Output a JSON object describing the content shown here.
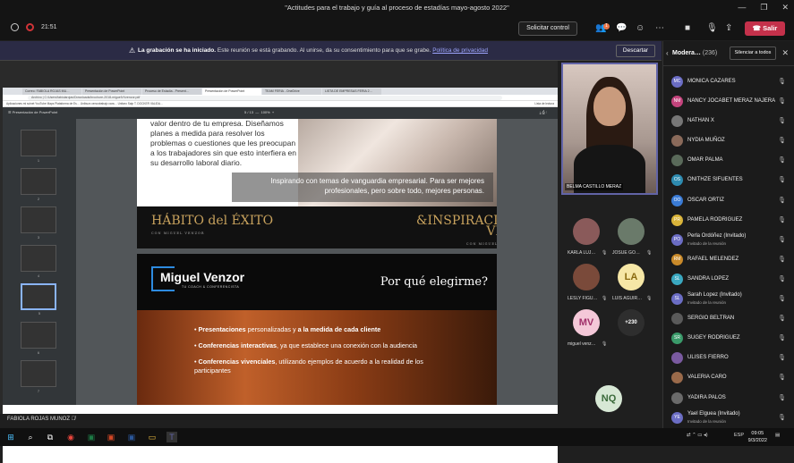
{
  "window": {
    "title": "\"Actitudes para el trabajo y guía al proceso de estadías mayo-agosto 2022\"",
    "timer": "21:51"
  },
  "toolbar": {
    "request_control": "Solicitar control",
    "participants_badge": "1",
    "leave": "Salir"
  },
  "banner": {
    "bold": "La grabación se ha iniciado.",
    "text": "Este reunión se está grabando. Al unirse, da su consentimiento para que se grabe.",
    "link": "Política de privacidad",
    "dismiss": "Descartar"
  },
  "browser": {
    "tabs": [
      "Correo: FABIOLA ROJAS MU…",
      "Presentación de PowerPoint",
      "Proceso de Estadía - Present…",
      "Presentación de PowerPoint",
      "TEAM FERIA - OneDrive",
      "LISTA DE EMPRESAS FERIA 2…"
    ],
    "url": "Archivo | C:/Users/fabiolarojas/Downloads/brochure-2018-miguelVVzenzor.pdf",
    "bookmarks": "Aplicaciones  mi scinet  YouTube  Maps  Plataforma de Es…  Unibuzz  cencotrabajo cara…  Unitaro Salp  T. DOCKER VALIDA…",
    "bookmarks_right": "Lista de lectura",
    "pdf_title": "Presentación de PowerPoint",
    "page_indicator": "5 / 13",
    "zoom": "100%"
  },
  "thumbnails": [
    "1",
    "2",
    "3",
    "4",
    "5",
    "6",
    "7"
  ],
  "slide1": {
    "body": "valor dentro de tu empresa. Diseñamos planes a medida para resolver los problemas o cuestiones que les preocupan a los trabajadores sin que esto interfiera en su desarrollo laboral diario.",
    "quote": "Inspirando con temas de vanguardia empresarial. Para ser mejores profesionales, pero sobre todo, mejores personas.",
    "logo_left": "HÁBITO del ÉXITO",
    "logo_left_sub": "CON MIGUEL VENZOR",
    "logo_right": "&INSPIRACIÓN VIDA",
    "logo_right_sub": "CON MIGUEL VENZOR"
  },
  "slide2": {
    "brand": "Miguel Venzor",
    "brand_sub": "TU COACH & CONFERENCISTA",
    "heading": "Por qué elegirme?",
    "bullets": [
      {
        "bold": "Presentaciones",
        "rest": " personalizadas y ",
        "bold2": "a la medida de cada cliente",
        "rest2": ""
      },
      {
        "bold": "Conferencias interactivas",
        "rest": ", ya que establece una conexión con la audiencia",
        "bold2": "",
        "rest2": ""
      },
      {
        "bold": "Conferencias vivenciales",
        "rest": ", utilizando ejemplos de acuerdo a la realidad de los participantes",
        "bold2": "",
        "rest2": ""
      }
    ]
  },
  "presenter_name": "FABIOLA ROJAS MUNOZ",
  "spotlight": {
    "name": "BELMA CASTILLO MERAZ"
  },
  "tiles": [
    {
      "name": "KARLA LUJ…",
      "initials": "",
      "color": "#8a5a5a"
    },
    {
      "name": "JOSUE GO…",
      "initials": "",
      "color": "#6a7a6a"
    },
    {
      "name": "LESLY FIGU…",
      "initials": "",
      "color": "#7a4a3a"
    },
    {
      "name": "LUIS AGUIR…",
      "initials": "LA",
      "color": "#f6e7a6"
    },
    {
      "name": "miguel venz…",
      "initials": "MV",
      "color": "#f4c8d8"
    },
    {
      "name": "",
      "initials": "+230",
      "color": "#2e2e2e"
    },
    {
      "name": "",
      "initials": "NQ",
      "color": "#d7e8d5"
    }
  ],
  "sidebar": {
    "title": "Modera…",
    "count": "(236)",
    "mute_all": "Silenciar a todos",
    "participants": [
      {
        "name": "MONICA CAZARES",
        "sub": "",
        "initials": "MC",
        "color": "#6b6dc4"
      },
      {
        "name": "NANCY JOCABET MERAZ NAJERA",
        "sub": "",
        "initials": "NM",
        "color": "#c4447d"
      },
      {
        "name": "NATHAN X",
        "sub": "",
        "initials": "",
        "color": "#777777"
      },
      {
        "name": "NYDIA MUÑOZ",
        "sub": "",
        "initials": "",
        "color": "#8a6a5a"
      },
      {
        "name": "OMAR PALMA",
        "sub": "",
        "initials": "",
        "color": "#5a6a5a"
      },
      {
        "name": "ONITHZE SIFUENTES",
        "sub": "",
        "initials": "OS",
        "color": "#2e8bb0"
      },
      {
        "name": "OSCAR ORTIZ",
        "sub": "",
        "initials": "OO",
        "color": "#3a7bd5"
      },
      {
        "name": "PAMELA RODRIGUEZ",
        "sub": "",
        "initials": "PR",
        "color": "#d9b43a"
      },
      {
        "name": "Perla Ordóñez (Invitado)",
        "sub": "Invitado de la reunión",
        "initials": "PO",
        "color": "#6b6dc4"
      },
      {
        "name": "RAFAEL MELENDEZ",
        "sub": "",
        "initials": "RM",
        "color": "#c98a2a"
      },
      {
        "name": "SANDRA LOPEZ",
        "sub": "",
        "initials": "SL",
        "color": "#3aa8c0"
      },
      {
        "name": "Sarah Lopez (Invitado)",
        "sub": "Invitado de la reunión",
        "initials": "SL",
        "color": "#6b6dc4"
      },
      {
        "name": "SERGIO BELTRAN",
        "sub": "",
        "initials": "",
        "color": "#5a5a5a"
      },
      {
        "name": "SUGEY RODRIGUEZ",
        "sub": "",
        "initials": "SR",
        "color": "#3a9a6a"
      },
      {
        "name": "ULISES FIERRO",
        "sub": "",
        "initials": "",
        "color": "#7a5aa0"
      },
      {
        "name": "VALERIA CARO",
        "sub": "",
        "initials": "",
        "color": "#9a6a4a"
      },
      {
        "name": "YADIRA PALOS",
        "sub": "",
        "initials": "",
        "color": "#6a6a6a"
      },
      {
        "name": "Yael Elguea (Invitado)",
        "sub": "Invitado de la reunión",
        "initials": "YE",
        "color": "#6b6dc4"
      }
    ]
  },
  "taskbar": {
    "lang": "ESP",
    "time": "09:05",
    "date": "9/3/2022"
  }
}
